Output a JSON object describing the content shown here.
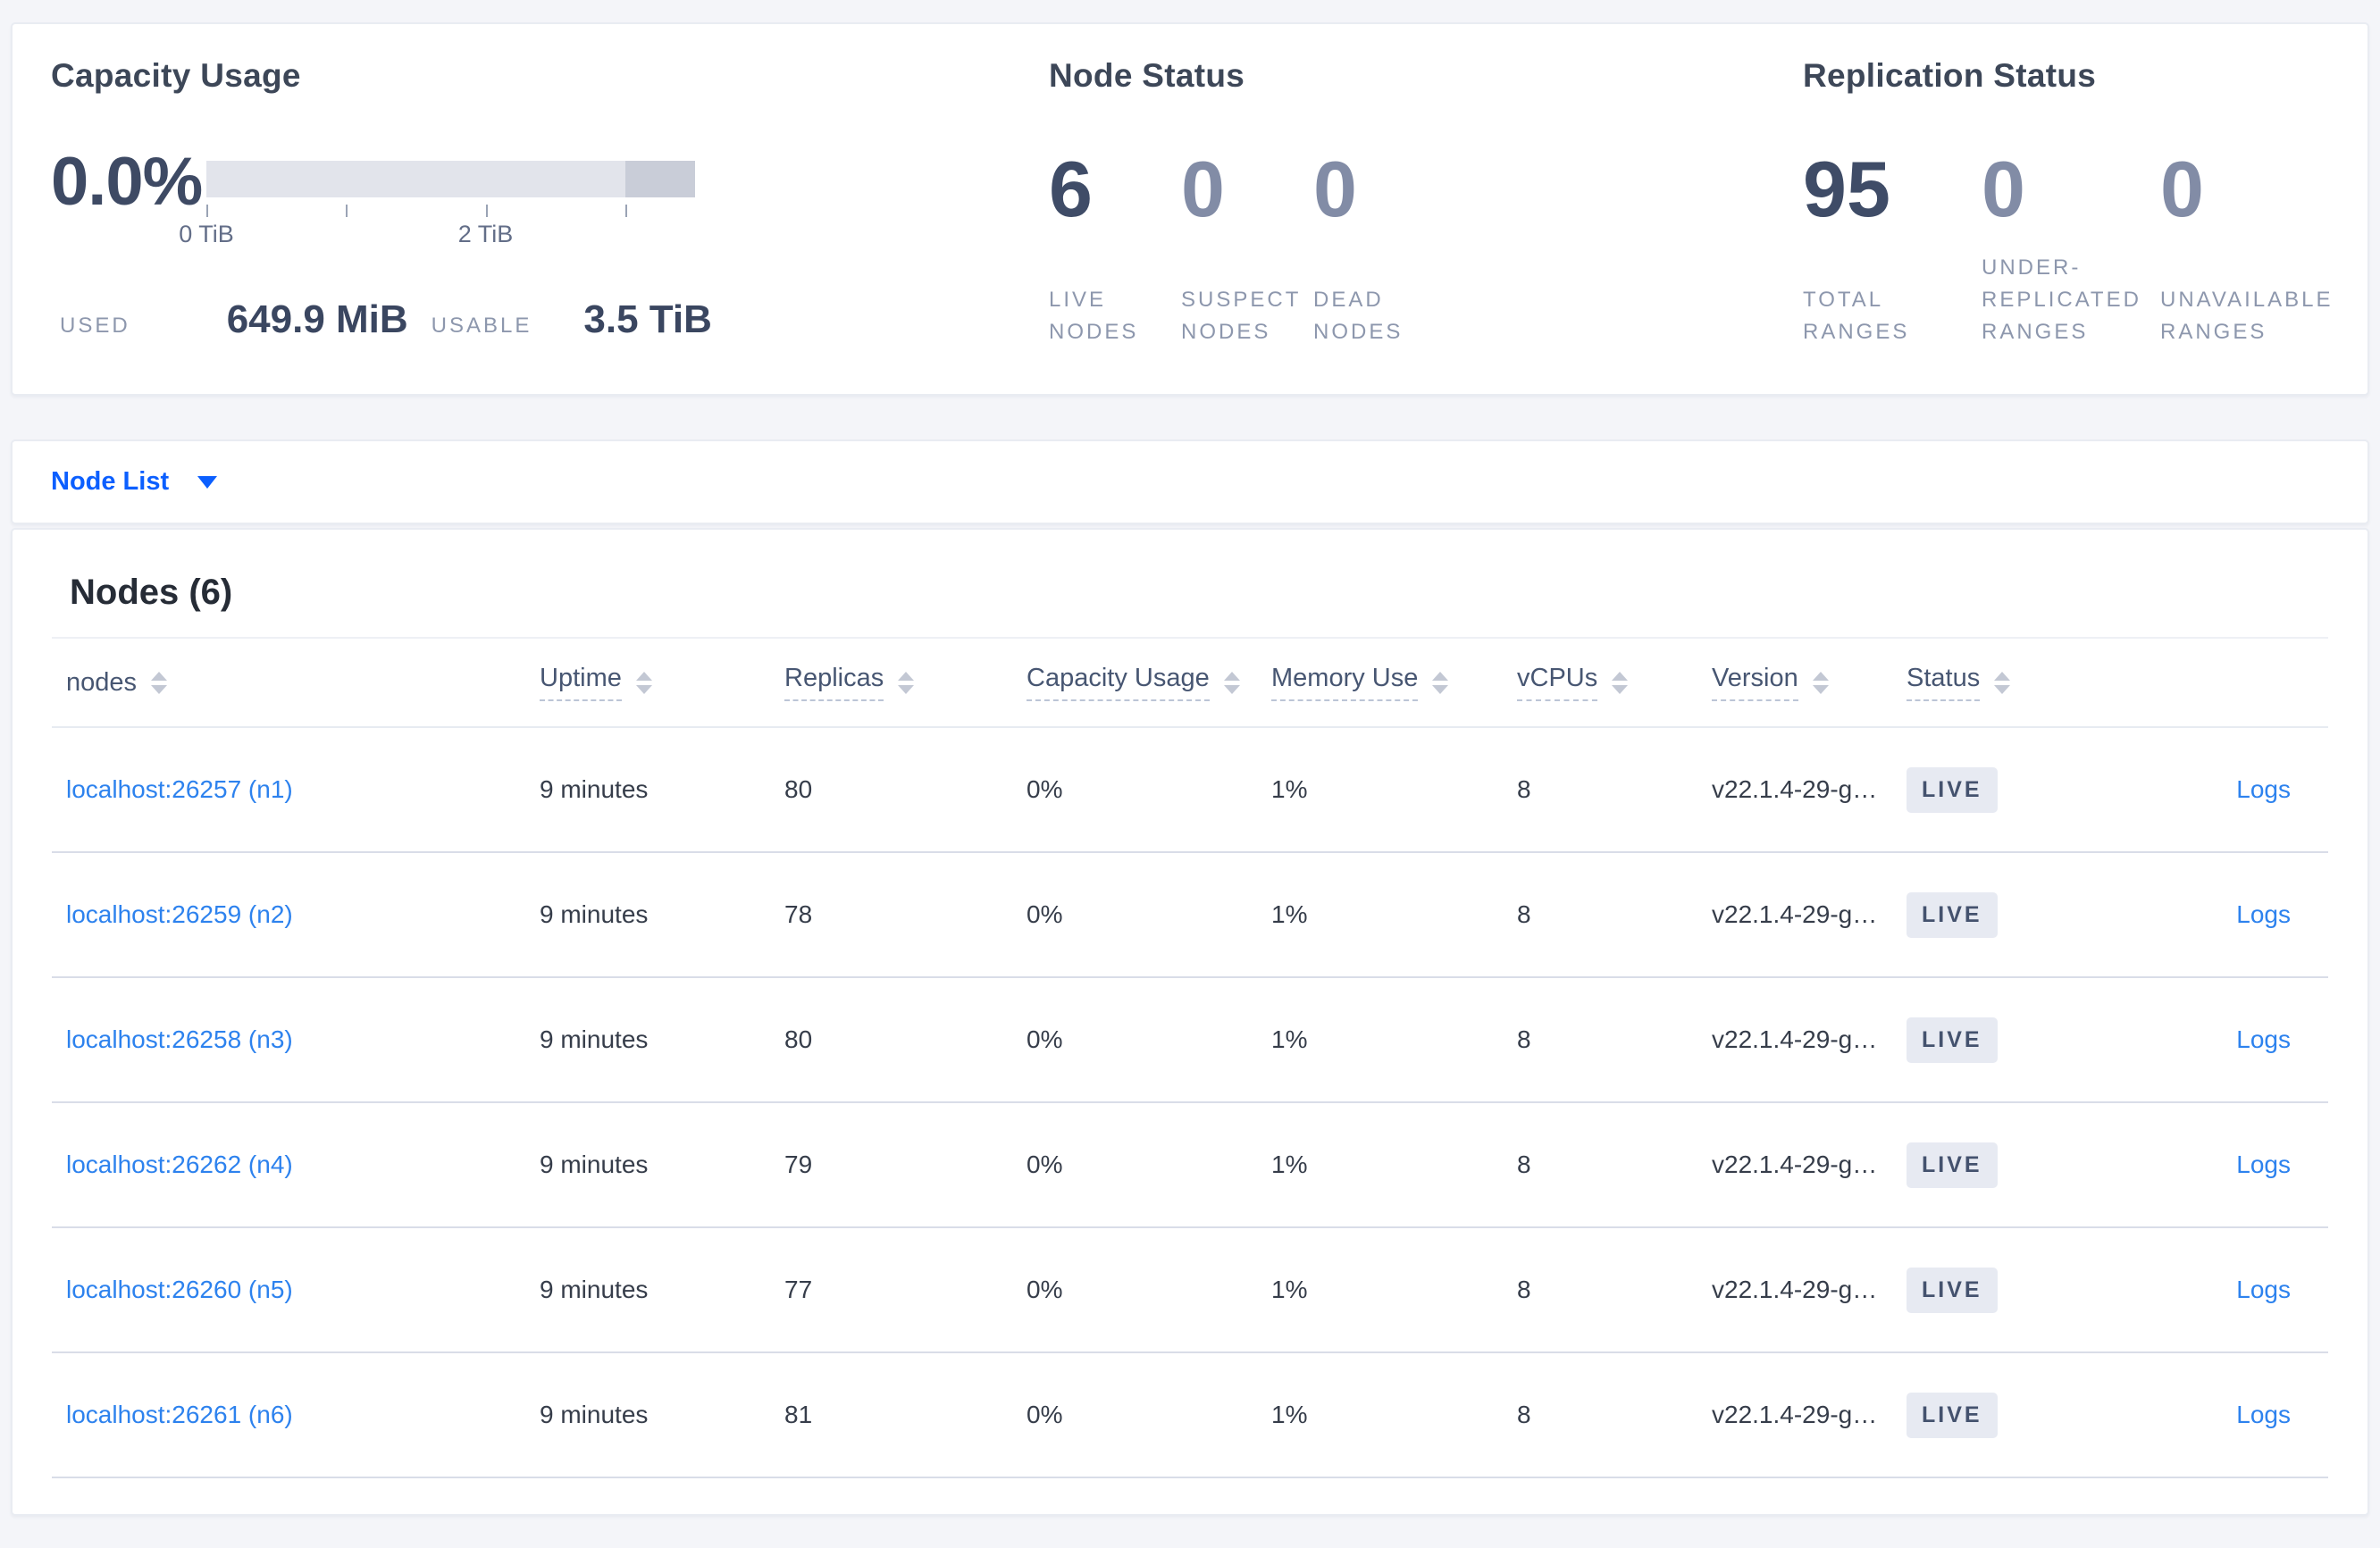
{
  "summary": {
    "capacity": {
      "title": "Capacity Usage",
      "percent": "0.0%",
      "tick_labels": [
        "0 TiB",
        "2 TiB"
      ],
      "used_label": "USED",
      "used_value": "649.9 MiB",
      "usable_label": "USABLE",
      "usable_value": "3.5 TiB",
      "bar_light_color": "#e2e4eb",
      "bar_dark_color": "#c9cdd8"
    },
    "node_status": {
      "title": "Node Status",
      "stats": [
        {
          "value": "6",
          "label": "LIVE NODES",
          "muted": false
        },
        {
          "value": "0",
          "label": "SUSPECT NODES",
          "muted": true
        },
        {
          "value": "0",
          "label": "DEAD NODES",
          "muted": true
        }
      ]
    },
    "replication": {
      "title": "Replication Status",
      "stats": [
        {
          "value": "95",
          "label": "TOTAL RANGES",
          "muted": false
        },
        {
          "value": "0",
          "label": "UNDER-REPLICATED RANGES",
          "muted": true
        },
        {
          "value": "0",
          "label": "UNAVAILABLE RANGES",
          "muted": true
        }
      ]
    }
  },
  "view_selector": {
    "label": "Node List"
  },
  "nodes_section": {
    "title": "Nodes (6)",
    "columns": [
      {
        "label": "nodes",
        "underline": false
      },
      {
        "label": "Uptime",
        "underline": true
      },
      {
        "label": "Replicas",
        "underline": true
      },
      {
        "label": "Capacity Usage",
        "underline": true
      },
      {
        "label": "Memory Use",
        "underline": true
      },
      {
        "label": "vCPUs",
        "underline": true
      },
      {
        "label": "Version",
        "underline": true
      },
      {
        "label": "Status",
        "underline": true
      },
      {
        "label": "",
        "underline": false
      }
    ],
    "rows": [
      {
        "node": "localhost:26257 (n1)",
        "uptime": "9 minutes",
        "replicas": "80",
        "capacity": "0%",
        "memory": "1%",
        "vcpus": "8",
        "version": "v22.1.4-29-g…",
        "status": "LIVE",
        "logs": "Logs"
      },
      {
        "node": "localhost:26259 (n2)",
        "uptime": "9 minutes",
        "replicas": "78",
        "capacity": "0%",
        "memory": "1%",
        "vcpus": "8",
        "version": "v22.1.4-29-g…",
        "status": "LIVE",
        "logs": "Logs"
      },
      {
        "node": "localhost:26258 (n3)",
        "uptime": "9 minutes",
        "replicas": "80",
        "capacity": "0%",
        "memory": "1%",
        "vcpus": "8",
        "version": "v22.1.4-29-g…",
        "status": "LIVE",
        "logs": "Logs"
      },
      {
        "node": "localhost:26262 (n4)",
        "uptime": "9 minutes",
        "replicas": "79",
        "capacity": "0%",
        "memory": "1%",
        "vcpus": "8",
        "version": "v22.1.4-29-g…",
        "status": "LIVE",
        "logs": "Logs"
      },
      {
        "node": "localhost:26260 (n5)",
        "uptime": "9 minutes",
        "replicas": "77",
        "capacity": "0%",
        "memory": "1%",
        "vcpus": "8",
        "version": "v22.1.4-29-g…",
        "status": "LIVE",
        "logs": "Logs"
      },
      {
        "node": "localhost:26261 (n6)",
        "uptime": "9 minutes",
        "replicas": "81",
        "capacity": "0%",
        "memory": "1%",
        "vcpus": "8",
        "version": "v22.1.4-29-g…",
        "status": "LIVE",
        "logs": "Logs"
      }
    ],
    "colors": {
      "link": "#2d82ee",
      "selector_link": "#0b5fff",
      "badge_bg": "#e7eaf2",
      "badge_text": "#44526e"
    }
  }
}
